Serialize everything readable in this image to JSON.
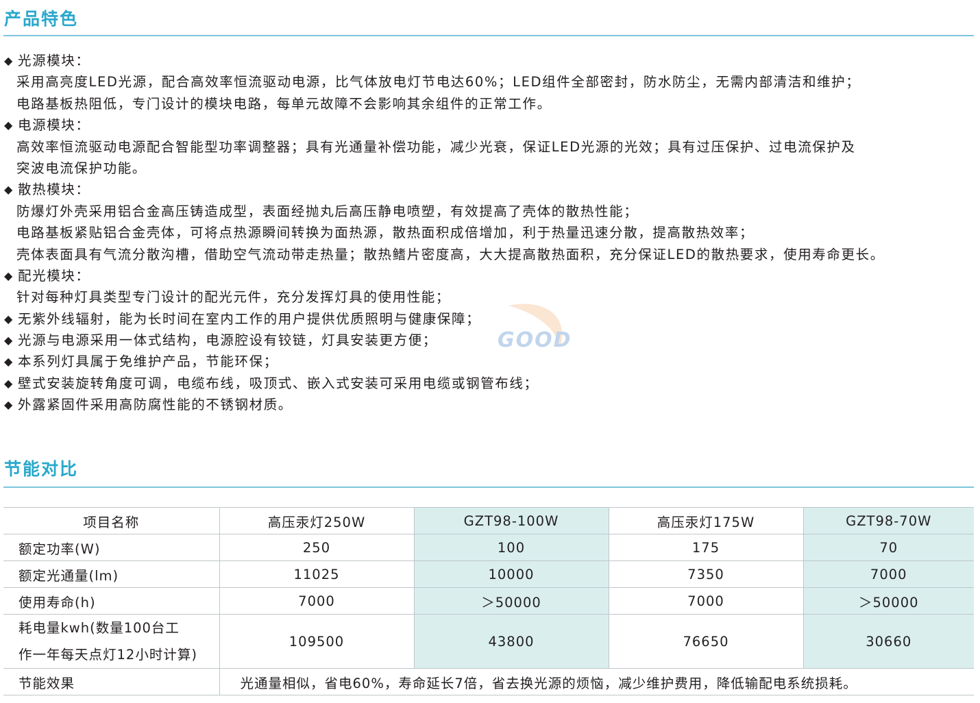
{
  "features_section": {
    "title": "产品特色",
    "lines": [
      {
        "bullet": "◆",
        "text": "光源模块："
      },
      {
        "bullet": "",
        "text": "采用高亮度LED光源，配合高效率恒流驱动电源，比气体放电灯节电达60%；LED组件全部密封，防水防尘，无需内部清洁和维护；"
      },
      {
        "bullet": "",
        "text": "电路基板热阻低，专门设计的模块电路，每单元故障不会影响其余组件的正常工作。"
      },
      {
        "bullet": "◆",
        "text": "电源模块："
      },
      {
        "bullet": "",
        "text": "高效率恒流驱动电源配合智能型功率调整器；具有光通量补偿功能，减少光衰，保证LED光源的光效；具有过压保护、过电流保护及"
      },
      {
        "bullet": "",
        "text": "突波电流保护功能。"
      },
      {
        "bullet": "◆",
        "text": "散热模块："
      },
      {
        "bullet": "",
        "text": "防爆灯外壳采用铝合金高压铸造成型，表面经抛丸后高压静电喷塑，有效提高了壳体的散热性能；"
      },
      {
        "bullet": "",
        "text": "电路基板紧贴铝合金壳体，可将点热源瞬间转换为面热源，散热面积成倍增加，利于热量迅速分散，提高散热效率；"
      },
      {
        "bullet": "",
        "text": "壳体表面具有气流分散沟槽，借助空气流动带走热量；散热鳍片密度高，大大提高散热面积，充分保证LED的散热要求，使用寿命更长。"
      },
      {
        "bullet": "◆",
        "text": "配光模块："
      },
      {
        "bullet": "",
        "text": "针对每种灯具类型专门设计的配光元件，充分发挥灯具的使用性能；"
      },
      {
        "bullet": "◆",
        "text": "无紫外线辐射，能为长时间在室内工作的用户提供优质照明与健康保障；"
      },
      {
        "bullet": "◆",
        "text": "光源与电源采用一体式结构，电源腔设有铰链，灯具安装更方便；"
      },
      {
        "bullet": "◆",
        "text": "本系列灯具属于免维护产品，节能环保；"
      },
      {
        "bullet": "◆",
        "text": "壁式安装旋转角度可调，电缆布线，吸顶式、嵌入式安装可采用电缆或钢管布线；"
      },
      {
        "bullet": "◆",
        "text": "外露紧固件采用高防腐性能的不锈钢材质。"
      }
    ]
  },
  "watermark": {
    "text": "GOOD",
    "colors": {
      "text": "#8fb4dd",
      "swoosh": "#f2b07a"
    }
  },
  "comparison_section": {
    "title": "节能对比",
    "headers": [
      "项目名称",
      "高压汞灯250W",
      "GZT98-100W",
      "高压汞灯175W",
      "GZT98-70W"
    ],
    "rows": [
      {
        "label": "额定功率(W)",
        "values": [
          "250",
          "100",
          "175",
          "70"
        ]
      },
      {
        "label": "额定光通量(lm)",
        "values": [
          "11025",
          "10000",
          "7350",
          "7000"
        ]
      },
      {
        "label": "使用寿命(h)",
        "values": [
          "7000",
          "＞50000",
          "7000",
          "＞50000"
        ]
      },
      {
        "label_line1": "耗电量kwh(数量100台工",
        "label_line2": "作一年每天点灯12小时计算)",
        "values": [
          "109500",
          "43800",
          "76650",
          "30660"
        ]
      }
    ],
    "effect": {
      "label": "节能效果",
      "text": "光通量相似，省电60%，寿命延长7倍，省去换光源的烦恼，减少维护费用，降低输配电系统损耗。"
    }
  },
  "colors": {
    "accent": "#2aa8cc",
    "rule": "#7cc5da",
    "shade": "#daeeee",
    "text": "#231f20"
  }
}
